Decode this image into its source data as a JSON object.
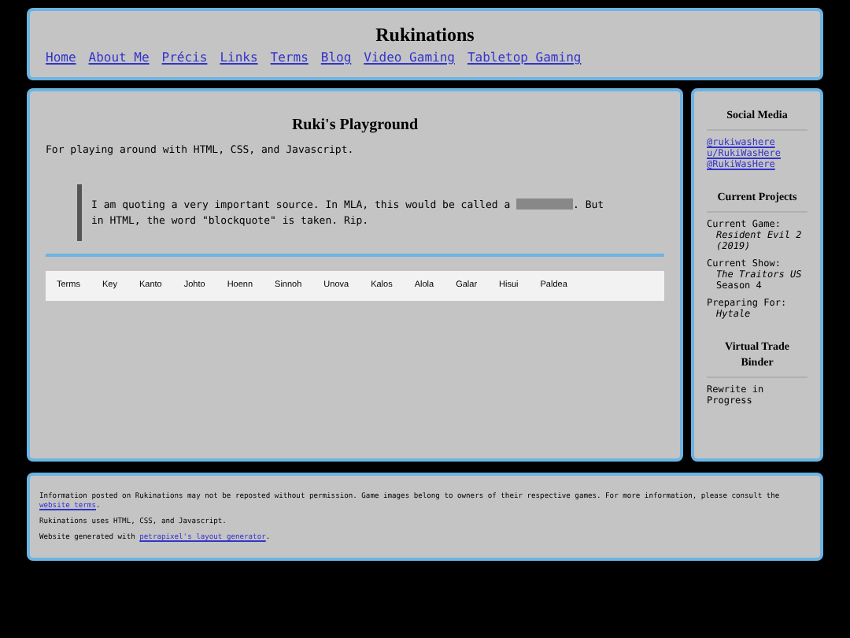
{
  "header": {
    "title": "Rukinations",
    "nav": [
      "Home",
      "About Me",
      "Précis",
      "Links",
      "Terms",
      "Blog",
      "Video Gaming",
      "Tabletop Gaming"
    ]
  },
  "main": {
    "title": "Ruki's Playground",
    "intro": "For playing around with HTML, CSS, and Javascript.",
    "quote": {
      "before": "I am quoting a very important source. In MLA, this would be called a",
      "after": ". But in HTML, the word \"blockquote\" is taken. Rip."
    },
    "tabs": [
      "Terms",
      "Key",
      "Kanto",
      "Johto",
      "Hoenn",
      "Sinnoh",
      "Unova",
      "Kalos",
      "Alola",
      "Galar",
      "Hisui",
      "Paldea"
    ]
  },
  "sidebar": [
    {
      "kind": "links",
      "title": "Social Media",
      "items": [
        "@rukiwashere",
        "u/RukiWasHere",
        "@RukiWasHere"
      ]
    },
    {
      "kind": "projects",
      "title": "Current Projects",
      "items": [
        {
          "label": "Current Game:",
          "value": "Resident Evil 2 (2019)"
        },
        {
          "label": "Current Show:",
          "value": "The Traitors US",
          "extra": "Season 4"
        },
        {
          "label": "Preparing For:",
          "value": "Hytale"
        }
      ]
    },
    {
      "kind": "text",
      "title": "Virtual Trade Binder",
      "text": "Rewrite in Progress"
    }
  ],
  "footer": [
    {
      "text": "Information posted on Rukinations may not be reposted without permission. Game images belong to owners of their respective games. For more information, please consult the",
      "link": "website terms",
      "after": "."
    },
    {
      "text": "Rukinations uses HTML, CSS, and Javascript."
    },
    {
      "text": "Website generated with",
      "link": "petrapixel's layout generator",
      "after": "."
    }
  ]
}
